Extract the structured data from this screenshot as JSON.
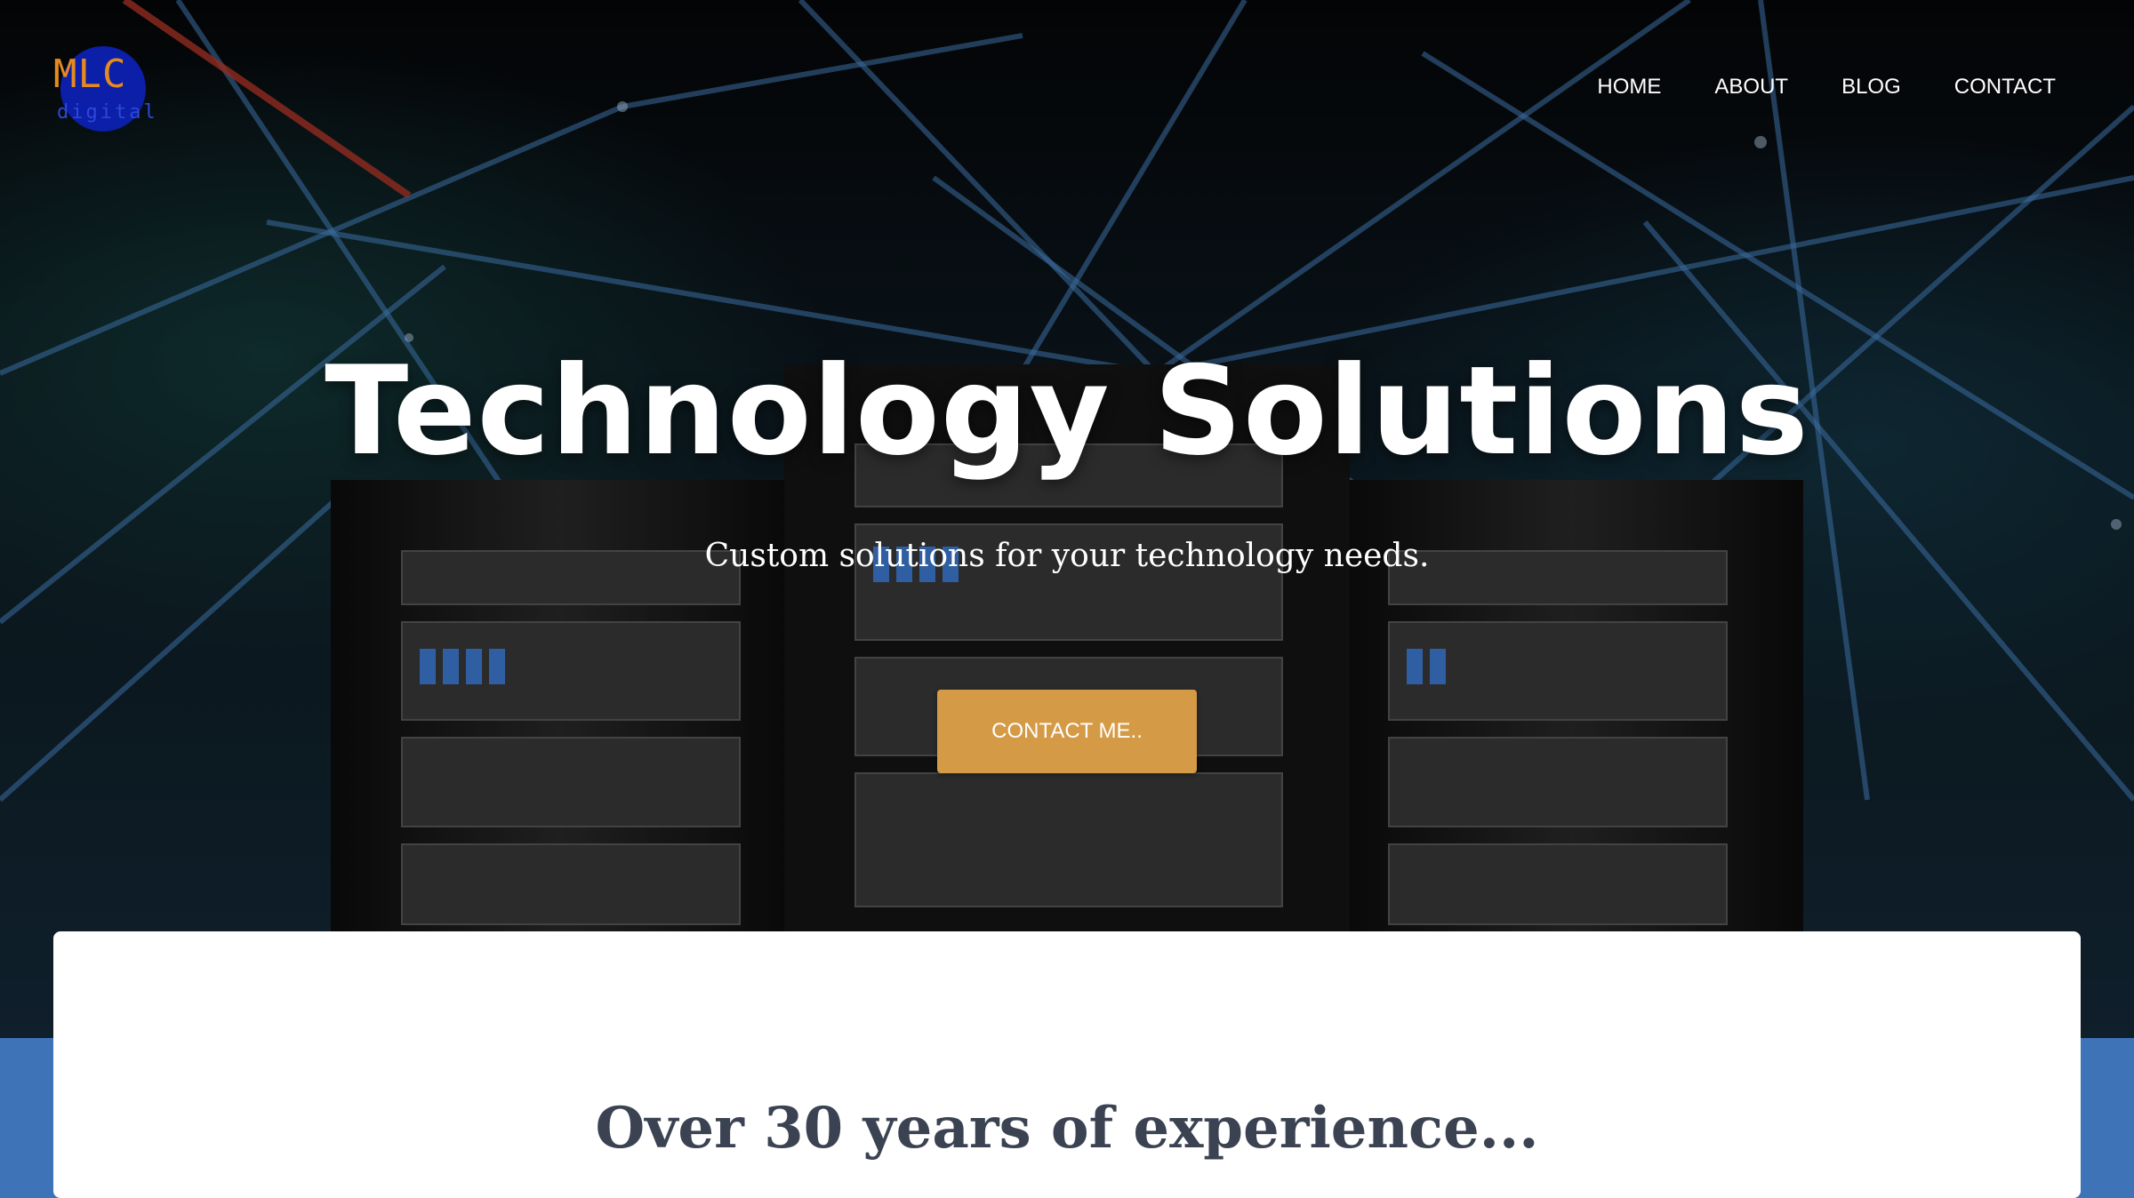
{
  "logo": {
    "main": "MLC",
    "sub": "digital"
  },
  "nav": {
    "home": "HOME",
    "about": "ABOUT",
    "blog": "BLOG",
    "contact": "CONTACT"
  },
  "hero": {
    "title": "Technology Solutions",
    "subtitle": "Custom solutions for your technology needs.",
    "cta_label": "CONTACT ME.."
  },
  "section": {
    "heading": "Over 30 years of experience..."
  },
  "colors": {
    "accent": "#d59a45",
    "footer_band": "#3f73b8",
    "heading_text": "#3b4352"
  }
}
